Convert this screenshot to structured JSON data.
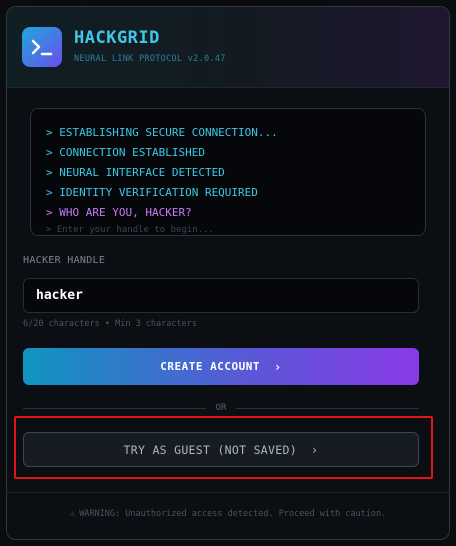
{
  "app": {
    "title": "HACKGRID",
    "subtitle": "NEURAL LINK PROTOCOL v2.0.47",
    "logo_icon": "terminal-prompt-icon",
    "logo_glyph": ">_"
  },
  "terminal": {
    "lines": [
      "> ESTABLISHING SECURE CONNECTION...",
      "> CONNECTION ESTABLISHED",
      "> NEURAL INTERFACE DETECTED",
      "> IDENTITY VERIFICATION REQUIRED",
      "> WHO ARE YOU, HACKER?"
    ],
    "hint": "> Enter your handle to begin..."
  },
  "form": {
    "handle_label": "HACKER HANDLE",
    "handle_value": "hacker",
    "char_count": "6/20 characters • Min 3 characters",
    "create_button": "CREATE ACCOUNT",
    "divider_text": "OR",
    "guest_button": "TRY AS GUEST (NOT SAVED)",
    "chevron": "›"
  },
  "footer": {
    "warning_icon": "warning-icon",
    "warning_glyph": "⚠",
    "warning_text": "WARNING: Unauthorized access detected. Proceed with caution."
  },
  "colors": {
    "accent_cyan": "#3ec8e8",
    "accent_purple": "#c27cf2",
    "highlight_red": "#e01616"
  }
}
